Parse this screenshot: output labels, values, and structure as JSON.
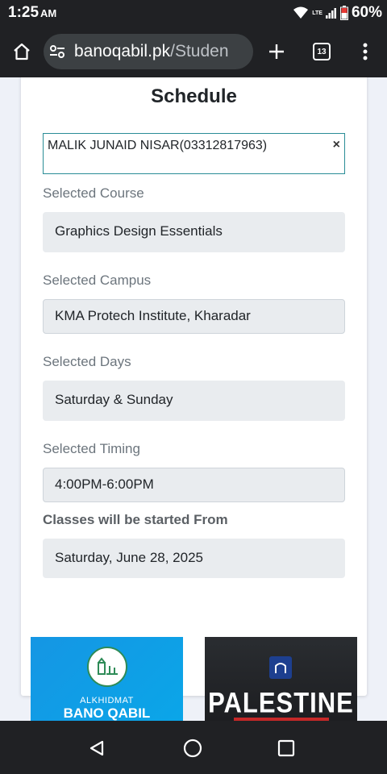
{
  "status": {
    "time": "1:25",
    "ampm": "AM",
    "network": "LTE",
    "battery": "60%"
  },
  "browser": {
    "url_domain": "banoqabil.pk",
    "url_path": "/Studen",
    "tab_count": "13"
  },
  "form": {
    "title": "Schedule",
    "student": "MALIK JUNAID NISAR(03312817963)",
    "clear_symbol": "×",
    "course_label": "Selected Course",
    "course_value": "Graphics Design Essentials",
    "campus_label": "Selected Campus",
    "campus_value": "KMA Protech Institute, Kharadar",
    "days_label": "Selected Days",
    "days_value": "Saturday & Sunday",
    "timing_label": "Selected Timing",
    "timing_value": "4:00PM-6:00PM",
    "start_label": "Classes will be started From",
    "start_value": "Saturday, June 28, 2025"
  },
  "promos": {
    "left_sub": "ALKHIDMAT",
    "left_main": "BANO QABIL",
    "right_main": "PALESTINE"
  },
  "icons": {
    "home": "home-icon",
    "site_settings": "tune-icon",
    "new_tab": "plus-icon",
    "menu": "more-vert-icon",
    "back": "back-triangle-icon",
    "home_nav": "home-circle-icon",
    "recents": "recents-square-icon"
  }
}
